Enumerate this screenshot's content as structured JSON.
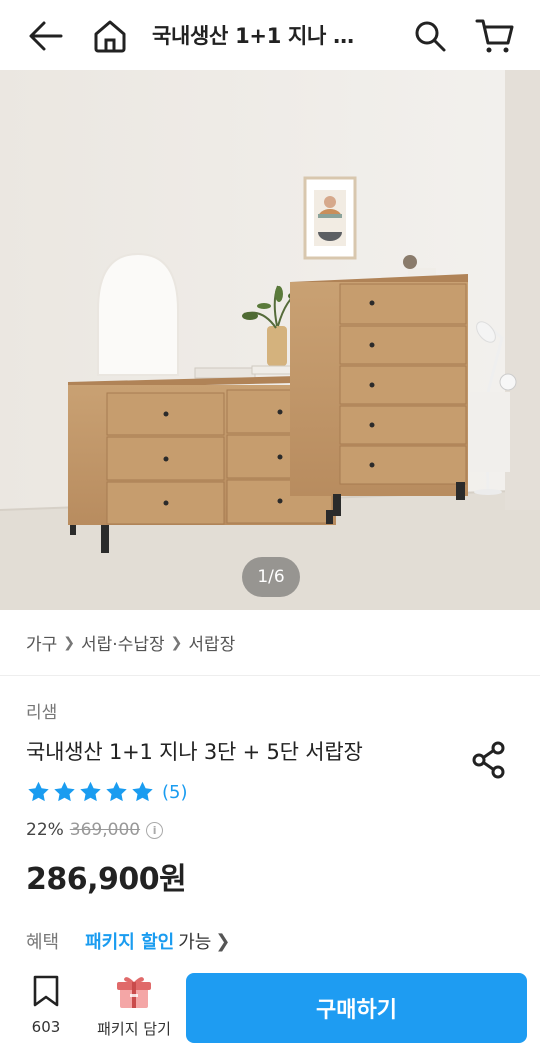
{
  "header": {
    "title": "국내생산 1+1 지나 …",
    "back_icon": "arrow-left-icon",
    "home_icon": "home-icon",
    "search_icon": "search-icon",
    "cart_icon": "cart-icon"
  },
  "gallery": {
    "pager": "1/6"
  },
  "breadcrumb": [
    "가구",
    "서랍·수납장",
    "서랍장"
  ],
  "product": {
    "brand": "리샘",
    "name": "국내생산 1+1 지나 3단 + 5단 서랍장",
    "rating": 5,
    "review_count": "(5)",
    "discount": "22%",
    "original_price": "369,000",
    "price": "286,900원"
  },
  "benefit": {
    "label": "혜택",
    "link": "패키지 할인",
    "suffix": "가능"
  },
  "bottom": {
    "bookmark_count": "603",
    "package_label": "패키지 담기",
    "buy_label": "구매하기"
  },
  "colors": {
    "accent": "#1e9cf2",
    "star": "#1a9cf0"
  }
}
